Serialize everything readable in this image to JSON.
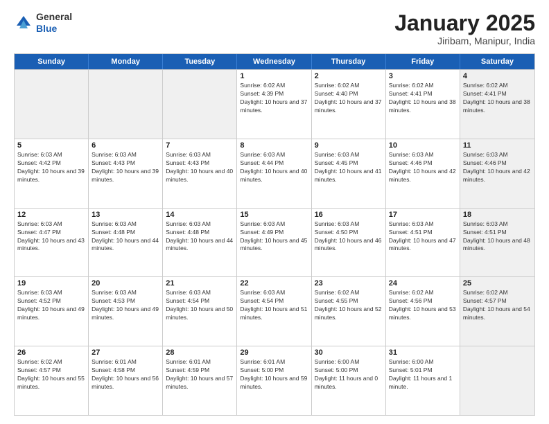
{
  "header": {
    "logo_general": "General",
    "logo_blue": "Blue",
    "title": "January 2025",
    "location": "Jiribam, Manipur, India"
  },
  "days_of_week": [
    "Sunday",
    "Monday",
    "Tuesday",
    "Wednesday",
    "Thursday",
    "Friday",
    "Saturday"
  ],
  "weeks": [
    [
      {
        "day": "",
        "info": "",
        "shaded": true
      },
      {
        "day": "",
        "info": "",
        "shaded": true
      },
      {
        "day": "",
        "info": "",
        "shaded": true
      },
      {
        "day": "1",
        "info": "Sunrise: 6:02 AM\nSunset: 4:39 PM\nDaylight: 10 hours and 37 minutes."
      },
      {
        "day": "2",
        "info": "Sunrise: 6:02 AM\nSunset: 4:40 PM\nDaylight: 10 hours and 37 minutes."
      },
      {
        "day": "3",
        "info": "Sunrise: 6:02 AM\nSunset: 4:41 PM\nDaylight: 10 hours and 38 minutes."
      },
      {
        "day": "4",
        "info": "Sunrise: 6:02 AM\nSunset: 4:41 PM\nDaylight: 10 hours and 38 minutes.",
        "shaded": true
      }
    ],
    [
      {
        "day": "5",
        "info": "Sunrise: 6:03 AM\nSunset: 4:42 PM\nDaylight: 10 hours and 39 minutes."
      },
      {
        "day": "6",
        "info": "Sunrise: 6:03 AM\nSunset: 4:43 PM\nDaylight: 10 hours and 39 minutes."
      },
      {
        "day": "7",
        "info": "Sunrise: 6:03 AM\nSunset: 4:43 PM\nDaylight: 10 hours and 40 minutes."
      },
      {
        "day": "8",
        "info": "Sunrise: 6:03 AM\nSunset: 4:44 PM\nDaylight: 10 hours and 40 minutes."
      },
      {
        "day": "9",
        "info": "Sunrise: 6:03 AM\nSunset: 4:45 PM\nDaylight: 10 hours and 41 minutes."
      },
      {
        "day": "10",
        "info": "Sunrise: 6:03 AM\nSunset: 4:46 PM\nDaylight: 10 hours and 42 minutes."
      },
      {
        "day": "11",
        "info": "Sunrise: 6:03 AM\nSunset: 4:46 PM\nDaylight: 10 hours and 42 minutes.",
        "shaded": true
      }
    ],
    [
      {
        "day": "12",
        "info": "Sunrise: 6:03 AM\nSunset: 4:47 PM\nDaylight: 10 hours and 43 minutes."
      },
      {
        "day": "13",
        "info": "Sunrise: 6:03 AM\nSunset: 4:48 PM\nDaylight: 10 hours and 44 minutes."
      },
      {
        "day": "14",
        "info": "Sunrise: 6:03 AM\nSunset: 4:48 PM\nDaylight: 10 hours and 44 minutes."
      },
      {
        "day": "15",
        "info": "Sunrise: 6:03 AM\nSunset: 4:49 PM\nDaylight: 10 hours and 45 minutes."
      },
      {
        "day": "16",
        "info": "Sunrise: 6:03 AM\nSunset: 4:50 PM\nDaylight: 10 hours and 46 minutes."
      },
      {
        "day": "17",
        "info": "Sunrise: 6:03 AM\nSunset: 4:51 PM\nDaylight: 10 hours and 47 minutes."
      },
      {
        "day": "18",
        "info": "Sunrise: 6:03 AM\nSunset: 4:51 PM\nDaylight: 10 hours and 48 minutes.",
        "shaded": true
      }
    ],
    [
      {
        "day": "19",
        "info": "Sunrise: 6:03 AM\nSunset: 4:52 PM\nDaylight: 10 hours and 49 minutes."
      },
      {
        "day": "20",
        "info": "Sunrise: 6:03 AM\nSunset: 4:53 PM\nDaylight: 10 hours and 49 minutes."
      },
      {
        "day": "21",
        "info": "Sunrise: 6:03 AM\nSunset: 4:54 PM\nDaylight: 10 hours and 50 minutes."
      },
      {
        "day": "22",
        "info": "Sunrise: 6:03 AM\nSunset: 4:54 PM\nDaylight: 10 hours and 51 minutes."
      },
      {
        "day": "23",
        "info": "Sunrise: 6:02 AM\nSunset: 4:55 PM\nDaylight: 10 hours and 52 minutes."
      },
      {
        "day": "24",
        "info": "Sunrise: 6:02 AM\nSunset: 4:56 PM\nDaylight: 10 hours and 53 minutes."
      },
      {
        "day": "25",
        "info": "Sunrise: 6:02 AM\nSunset: 4:57 PM\nDaylight: 10 hours and 54 minutes.",
        "shaded": true
      }
    ],
    [
      {
        "day": "26",
        "info": "Sunrise: 6:02 AM\nSunset: 4:57 PM\nDaylight: 10 hours and 55 minutes."
      },
      {
        "day": "27",
        "info": "Sunrise: 6:01 AM\nSunset: 4:58 PM\nDaylight: 10 hours and 56 minutes."
      },
      {
        "day": "28",
        "info": "Sunrise: 6:01 AM\nSunset: 4:59 PM\nDaylight: 10 hours and 57 minutes."
      },
      {
        "day": "29",
        "info": "Sunrise: 6:01 AM\nSunset: 5:00 PM\nDaylight: 10 hours and 59 minutes."
      },
      {
        "day": "30",
        "info": "Sunrise: 6:00 AM\nSunset: 5:00 PM\nDaylight: 11 hours and 0 minutes."
      },
      {
        "day": "31",
        "info": "Sunrise: 6:00 AM\nSunset: 5:01 PM\nDaylight: 11 hours and 1 minute."
      },
      {
        "day": "",
        "info": "",
        "shaded": true
      }
    ]
  ]
}
